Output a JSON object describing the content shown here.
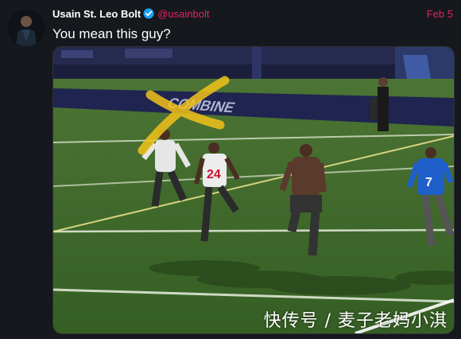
{
  "tweet": {
    "author_name": "Usain St. Leo Bolt",
    "handle": "@usainbolt",
    "date": "Feb 5",
    "text": "You mean this guy?",
    "verified": true
  },
  "media": {
    "jersey_numbers": [
      "24",
      "7"
    ],
    "stadium_lettering": "COMBINE",
    "watermark": "快传号 / 麦子老妈小淇"
  },
  "colors": {
    "background": "#15181c",
    "accent": "#e0245e",
    "verified_badge": "#1da1f2",
    "field": "#3d6a2a",
    "highlight_x": "#f2c21a"
  }
}
